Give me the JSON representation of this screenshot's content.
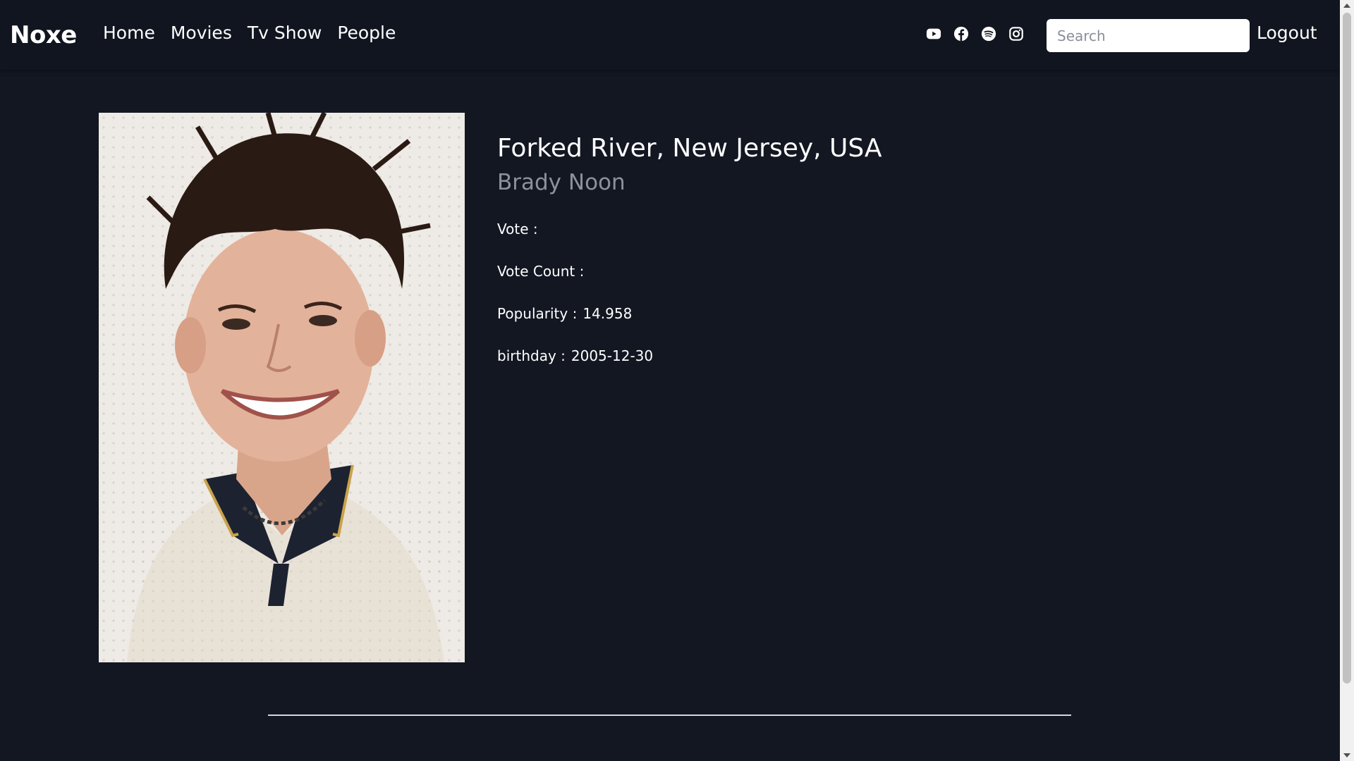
{
  "navbar": {
    "brand": "Noxe",
    "links": [
      {
        "label": "Home"
      },
      {
        "label": "Movies"
      },
      {
        "label": "Tv Show"
      },
      {
        "label": "People"
      }
    ],
    "socials": [
      {
        "icon": "youtube-icon"
      },
      {
        "icon": "facebook-icon"
      },
      {
        "icon": "spotify-icon"
      },
      {
        "icon": "instagram-icon"
      }
    ],
    "search": {
      "placeholder": "Search",
      "value": ""
    },
    "logout_label": "Logout"
  },
  "person": {
    "photo_alt": "Brady Noon",
    "place_of_birth": "Forked River, New Jersey, USA",
    "name": "Brady Noon",
    "vote_label": "Vote :",
    "vote_value": "",
    "vote_count_label": "Vote Count :",
    "vote_count_value": "",
    "popularity_label": "Popularity :",
    "popularity_value": "14.958",
    "birthday_label": "birthday :",
    "birthday_value": "2005-12-30"
  },
  "colors": {
    "background": "#131722",
    "navbar": "#111520",
    "text": "#ffffff",
    "muted": "#8d929a"
  }
}
